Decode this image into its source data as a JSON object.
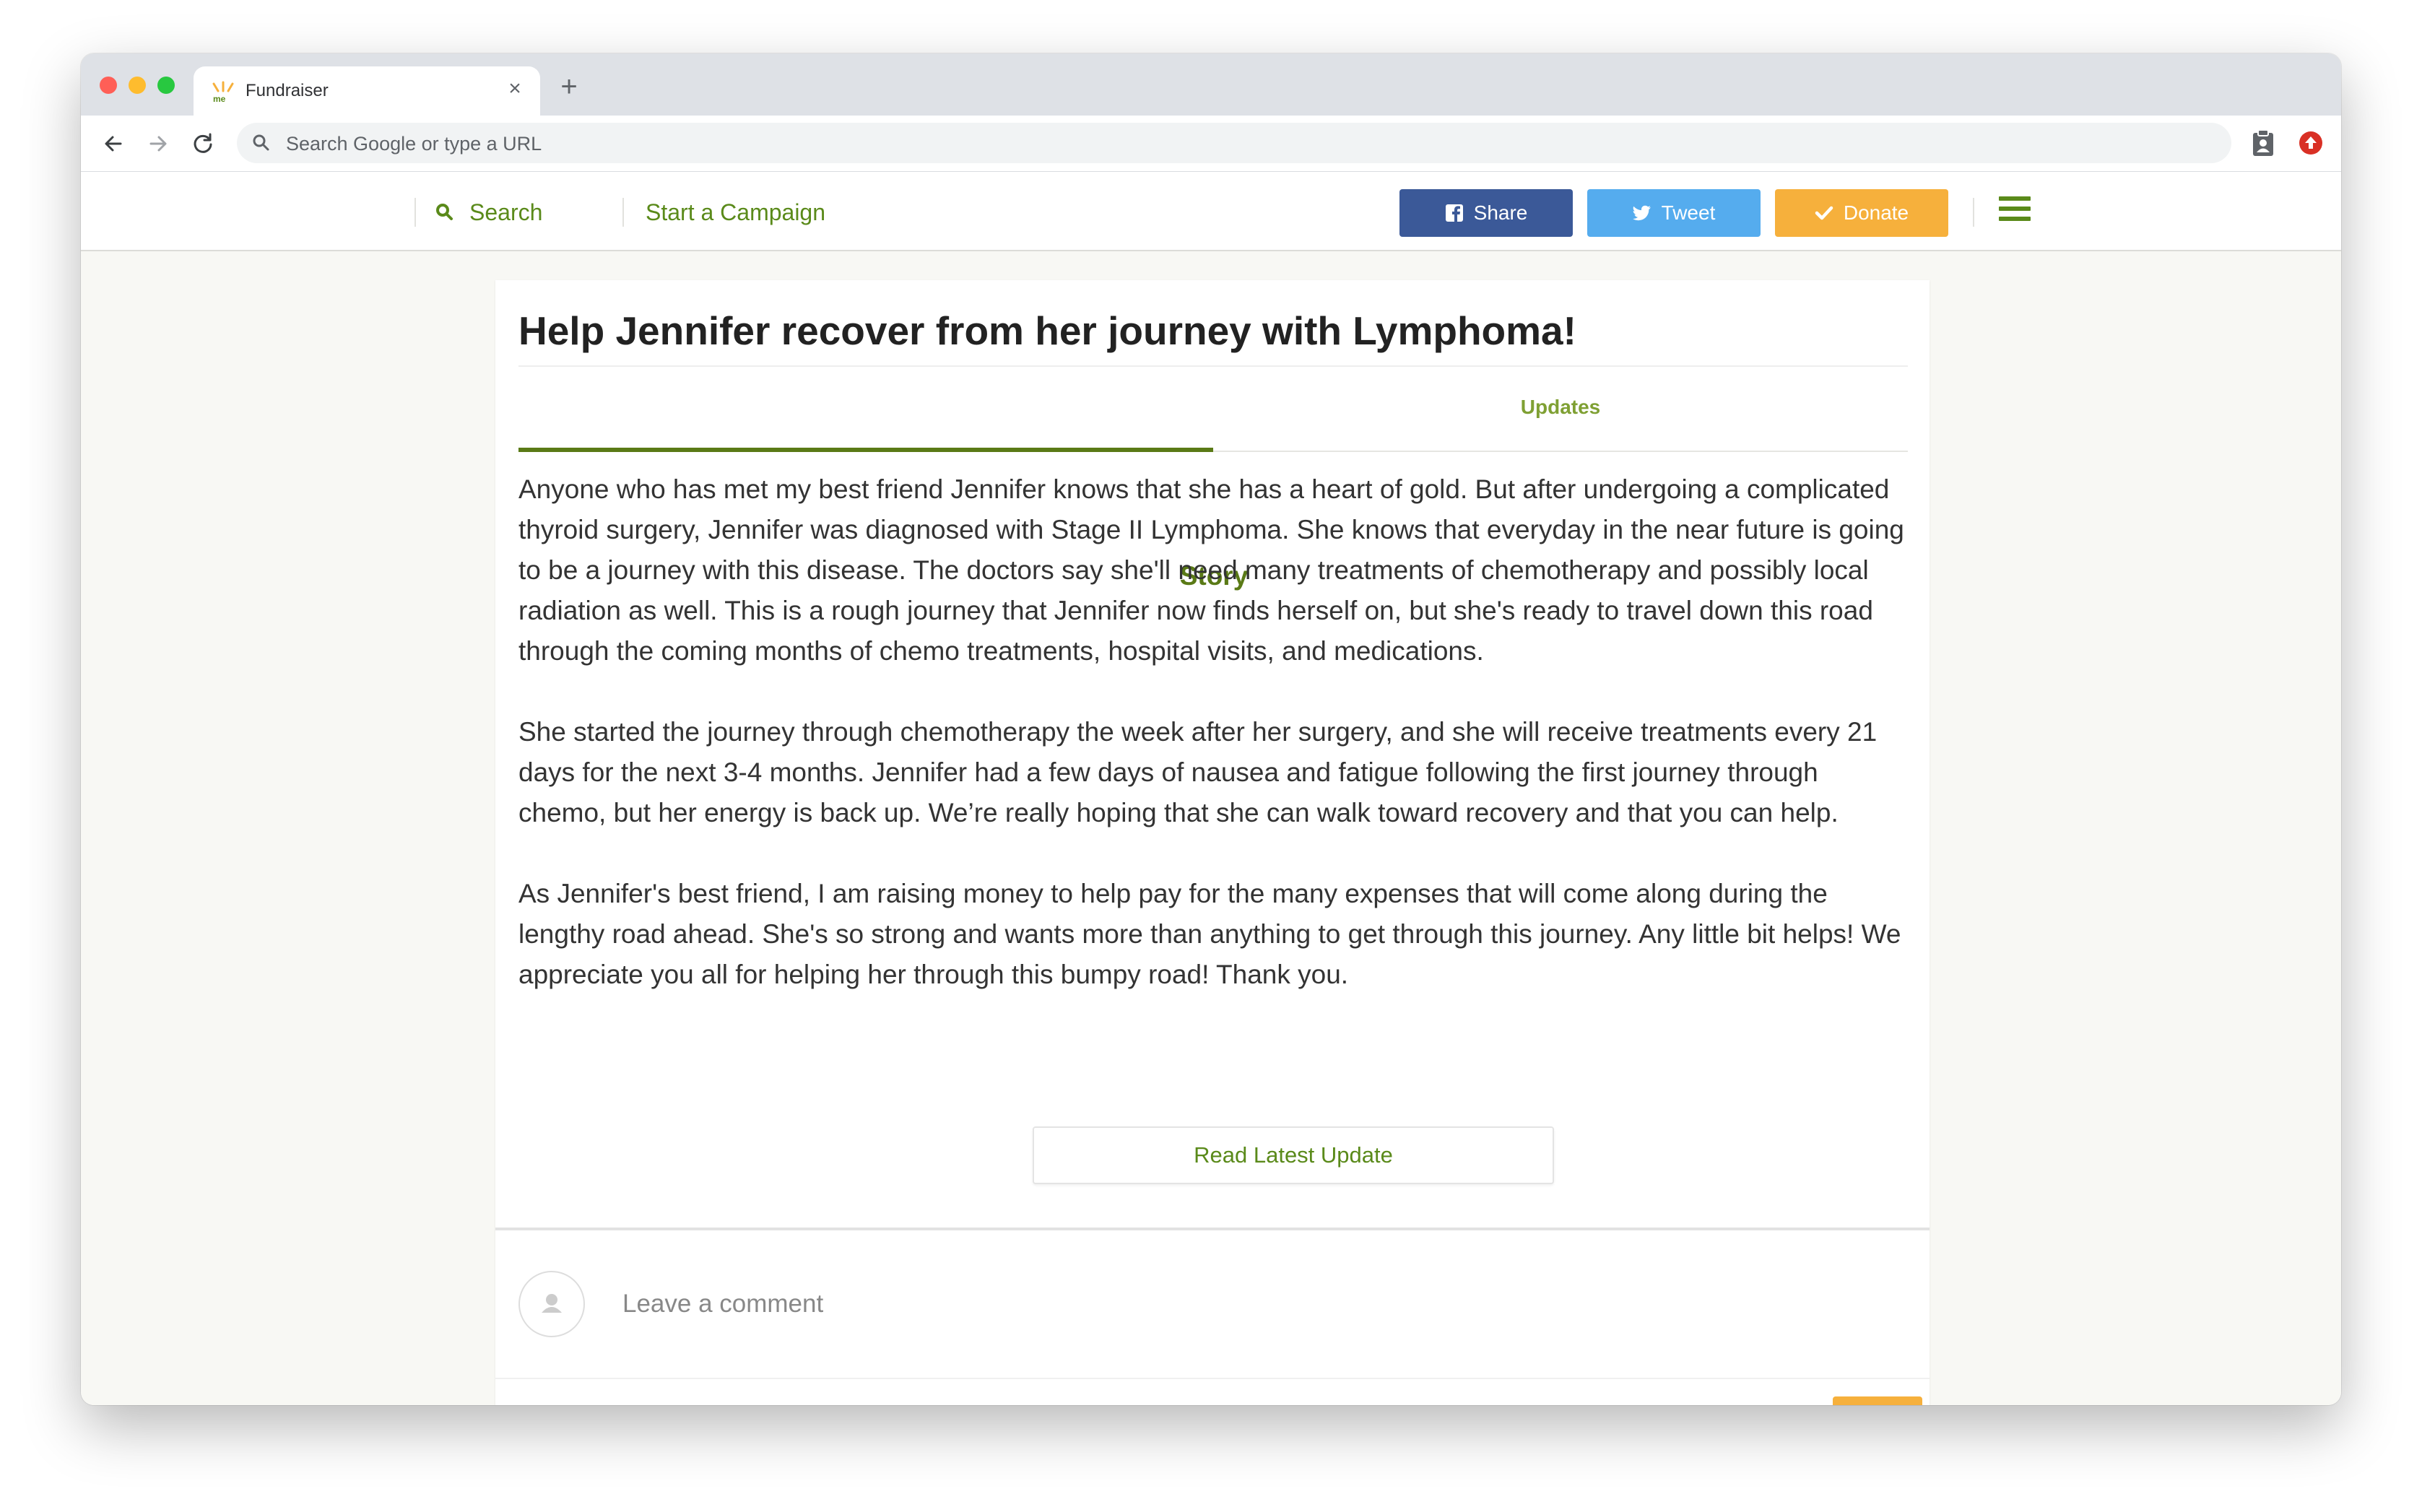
{
  "browser": {
    "tab_title": "Fundraiser",
    "new_tab_label": "+",
    "omnibox_placeholder": "Search Google or type a URL"
  },
  "header": {
    "search_label": "Search",
    "start_campaign_label": "Start a Campaign",
    "share_label": "Share",
    "tweet_label": "Tweet",
    "donate_label": "Donate",
    "colors": {
      "brand_green": "#5a8a1a",
      "share": "#3b5998",
      "tweet": "#55acee",
      "donate": "#f6b03c"
    }
  },
  "campaign": {
    "title": "Help Jennifer recover from her journey with Lymphoma!",
    "tabs": [
      {
        "label": "Story",
        "active": true
      },
      {
        "label": "Updates",
        "active": false
      }
    ],
    "story_paragraphs": [
      "Anyone who has met my best friend Jennifer knows that she has a heart of gold. But after undergoing a complicated thyroid surgery, Jennifer was diagnosed with Stage II Lymphoma. She knows that everyday in the near future is going to be a journey with this disease. The doctors say she'll need many treatments of chemotherapy and possibly local radiation as well. This is a rough journey that Jennifer now finds herself on, but she's ready to travel down this road through the coming months of chemo treatments, hospital visits, and medications.",
      "She started the journey through chemotherapy the week after her surgery, and she will receive treatments every 21 days for the next 3-4 months. Jennifer had a few days of nausea and fatigue following the first journey through chemo, but her energy is back up. We’re really hoping that she can walk toward recovery and that you can help.",
      "As Jennifer's best friend, I am raising money to help pay for the many expenses that will come along during the lengthy road ahead. She's so strong and wants more than anything to get through this journey. Any little bit helps! We appreciate you all for helping her through this bumpy road! Thank you."
    ],
    "read_latest_label": "Read Latest Update",
    "comment_placeholder": "Leave a comment"
  }
}
